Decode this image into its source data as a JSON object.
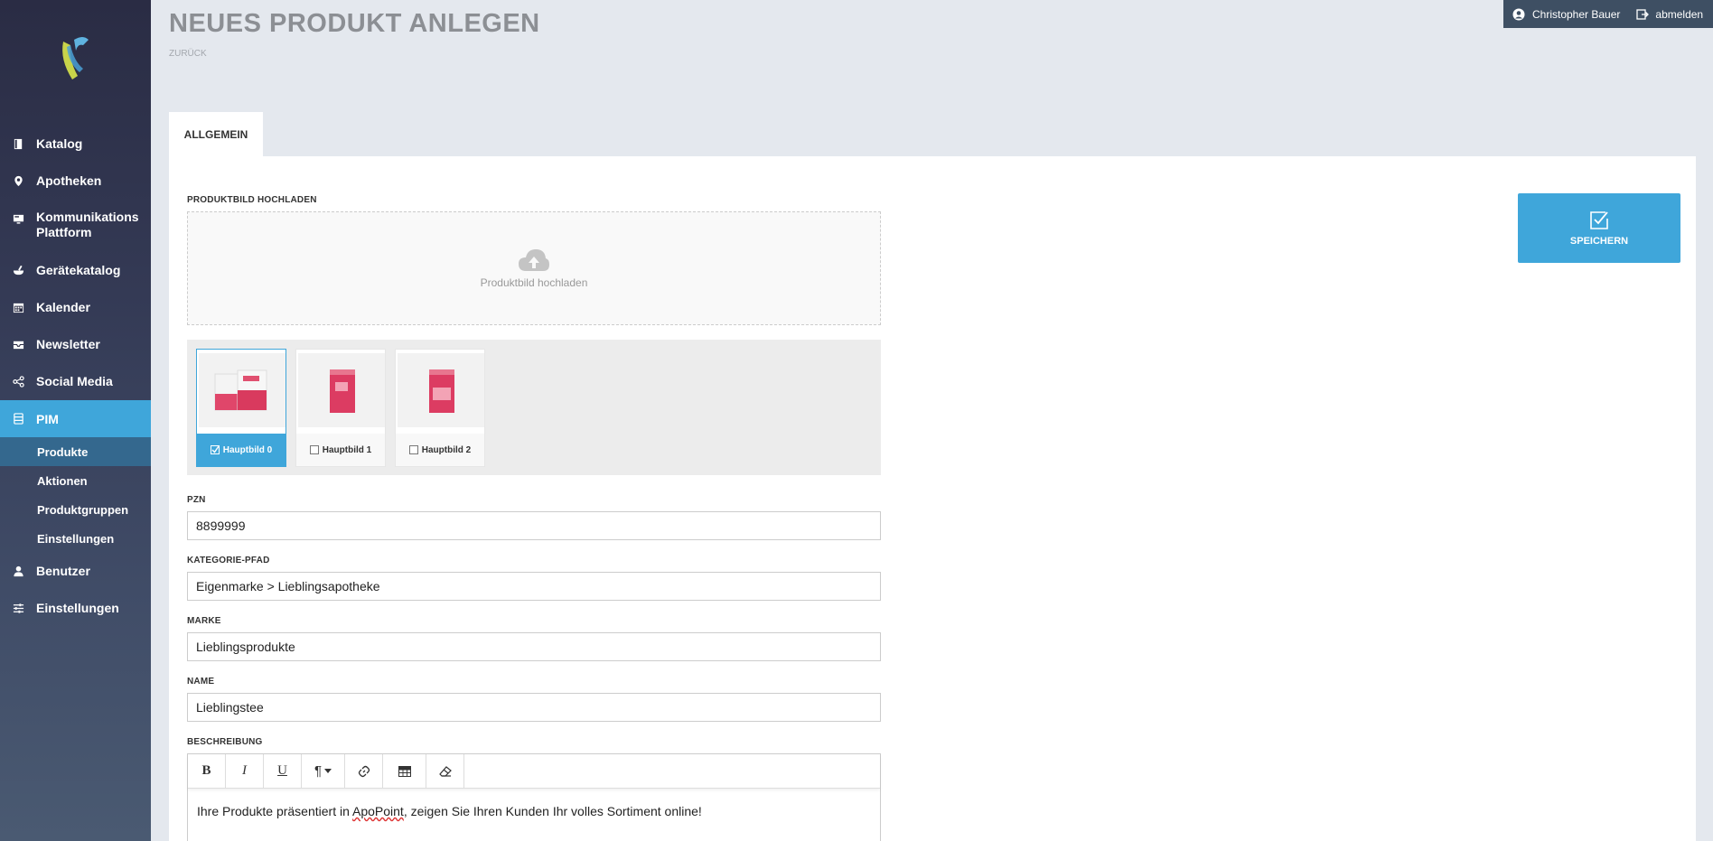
{
  "header": {
    "title": "NEUES PRODUKT ANLEGEN",
    "back": "ZURÜCK"
  },
  "user": {
    "name": "Christopher Bauer",
    "logout": "abmelden"
  },
  "sidebar": {
    "items": [
      {
        "label": "Katalog",
        "icon": "book-icon"
      },
      {
        "label": "Apotheken",
        "icon": "map-pin-icon"
      },
      {
        "label": "Kommunikations Plattform",
        "icon": "monitor-icon"
      },
      {
        "label": "Gerätekatalog",
        "icon": "mortar-icon"
      },
      {
        "label": "Kalender",
        "icon": "calendar-icon"
      },
      {
        "label": "Newsletter",
        "icon": "newsletter-icon"
      },
      {
        "label": "Social Media",
        "icon": "share-icon"
      },
      {
        "label": "PIM",
        "icon": "database-icon"
      },
      {
        "label": "Benutzer",
        "icon": "user-icon"
      },
      {
        "label": "Einstellungen",
        "icon": "sliders-icon"
      }
    ],
    "pim_sub": [
      "Produkte",
      "Aktionen",
      "Produktgruppen",
      "Einstellungen"
    ]
  },
  "tab": {
    "label": "ALLGEMEIN"
  },
  "upload": {
    "label": "PRODUKTBILD HOCHLADEN",
    "text": "Produktbild hochladen"
  },
  "images": [
    "Hauptbild 0",
    "Hauptbild 1",
    "Hauptbild 2"
  ],
  "fields": {
    "pzn": {
      "label": "PZN",
      "value": "8899999"
    },
    "kategorie": {
      "label": "KATEGORIE-PFAD",
      "value": "Eigenmarke > Lieblingsapotheke"
    },
    "marke": {
      "label": "MARKE",
      "value": "Lieblingsprodukte"
    },
    "name": {
      "label": "NAME",
      "value": "Lieblingstee"
    }
  },
  "beschreibung": {
    "label": "BESCHREIBUNG",
    "toolbar": {
      "bold": "B",
      "italic": "I",
      "underline": "U",
      "paragraph": "¶"
    },
    "text_before": "Ihre Produkte präsentiert in ",
    "text_brand": "ApoPoint",
    "text_after": ", zeigen Sie Ihren Kunden Ihr volles Sortiment online!"
  },
  "save_button": {
    "label": "SPEICHERN"
  },
  "colors": {
    "accent": "#3fa6da",
    "sidebar_dark": "#2a2c44",
    "sub_active": "#34688e"
  }
}
